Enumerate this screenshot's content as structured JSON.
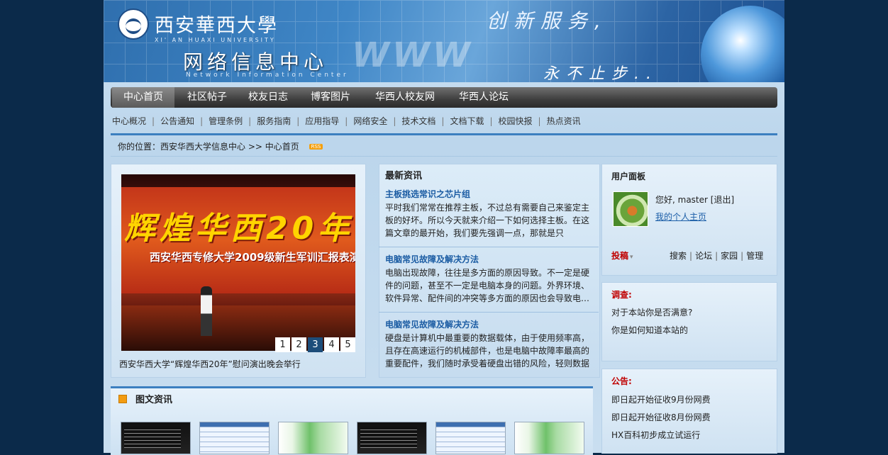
{
  "header": {
    "university_cn": "西安華西大學",
    "university_en": "XI' AN HUAXI UNIVERSITY",
    "site_title": "网络信息中心",
    "site_en": "Network Information Center",
    "decor_www": "WWW",
    "slogan_1": "创新服务,",
    "slogan_2": "永不止步.."
  },
  "nav": {
    "items": [
      {
        "label": "中心首页",
        "active": true
      },
      {
        "label": "社区帖子"
      },
      {
        "label": "校友日志"
      },
      {
        "label": "博客图片"
      },
      {
        "label": "华西人校友网"
      },
      {
        "label": "华西人论坛"
      }
    ]
  },
  "subnav": {
    "items": [
      "中心概况",
      "公告通知",
      "管理条例",
      "服务指南",
      "应用指导",
      "网络安全",
      "技术文档",
      "文档下载",
      "校园快报",
      "热点资讯"
    ],
    "separator": "|"
  },
  "breadcrumb": {
    "text": "你的位置：西安华西大学信息中心 >> 中心首页",
    "rss": "RSS"
  },
  "slideshow": {
    "headline_text": "辉煌华西20年",
    "subline_text": "西安华西专修大学2009级新生军训汇报表演",
    "pages": [
      "1",
      "2",
      "3",
      "4",
      "5"
    ],
    "current_page": "3",
    "caption": "西安华西大学“辉煌华西20年”慰问演出晚会举行"
  },
  "news": {
    "title": "最新资讯",
    "items": [
      {
        "headline": "主板挑选常识之芯片组",
        "summary": "平时我们常常在推荐主板，不过总有需要自己来鉴定主板的好坏。所以今天就来介绍一下如何选择主板。在这篇文章的最开始，我们要先强调一点，那就是只"
      },
      {
        "headline": "电脑常见故障及解决方法",
        "summary": " 电脑出现故障，往往是多方面的原因导致。不一定是硬件的问题，甚至不一定是电脑本身的问题。外界环境、软件异常、配件间的冲突等多方面的原因也会导致电…"
      },
      {
        "headline": "电脑常见故障及解决方法",
        "summary": "硬盘是计算机中最重要的数据载体，由于使用频率高，且存在高速运行的机械部件，也是电脑中故障率最高的重要配件，我们随时承受着硬盘出错的风险，轻则数据"
      }
    ]
  },
  "user_panel": {
    "title": "用户面板",
    "greeting": "您好, master [退出]",
    "home_link": "我的个人主页",
    "post_button": "投稿",
    "links": [
      "搜索",
      "论坛",
      "家园",
      "管理"
    ],
    "link_separator": "|"
  },
  "survey": {
    "title": "调查:",
    "items": [
      "对于本站你是否满意?",
      "你是如何知道本站的"
    ]
  },
  "notice": {
    "title": "公告:",
    "items": [
      "即日起开始征收9月份网费",
      "即日起开始征收8月份网费",
      "HX百科初步成立试运行"
    ]
  },
  "gallery": {
    "title": "图文资讯",
    "thumbs": [
      "dark",
      "table",
      "green",
      "dark",
      "table",
      "green"
    ]
  },
  "colors": {
    "link_blue": "#1b5ca3",
    "alert_red": "#c00000",
    "nav_dark": "#3e3e3e"
  }
}
